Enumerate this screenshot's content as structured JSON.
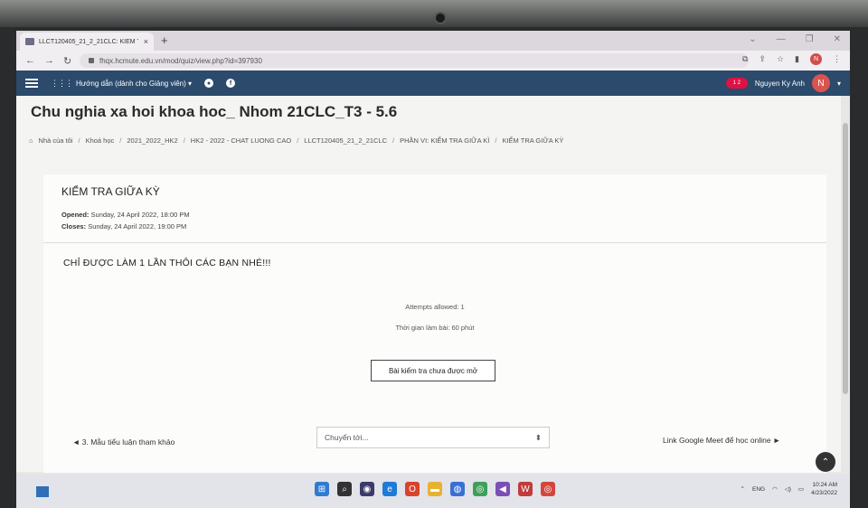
{
  "browser": {
    "tab_title": "LLCT120405_21_2_21CLC: KIỂM T",
    "tab_close": "×",
    "new_tab": "+",
    "url": "fhqx.hcmute.edu.vn/mod/quiz/view.php?id=397930"
  },
  "topnav": {
    "guide_label": "Hướng dẫn (dành cho Giảng viên) ▾",
    "user_name": "Nguyen Ky Anh",
    "user_initial": "N",
    "notification_badge": "1 2"
  },
  "course": {
    "title": "Chu nghia xa hoi khoa hoc_ Nhom 21CLC_T3 - 5.6"
  },
  "breadcrumb": [
    "Nhà của tôi",
    "Khoá học",
    "2021_2022_HK2",
    "HK2 - 2022 - CHAT LUONG CAO",
    "LLCT120405_21_2_21CLC",
    "PHẦN VI: KIỂM TRA GIỮA KÌ",
    "KIỂM TRA GIỮA KỲ"
  ],
  "quiz": {
    "name": "KIỂM TRA GIỮA KỲ",
    "opened_label": "Opened:",
    "opened_value": "Sunday, 24 April 2022, 18:00 PM",
    "closes_label": "Closes:",
    "closes_value": "Sunday, 24 April 2022, 19:00 PM",
    "notice": "CHỈ ĐƯỢC LÀM 1 LẦN THÔI CÁC BẠN NHÉ!!!",
    "attempts": "Attempts allowed: 1",
    "time_limit": "Thời gian làm bài: 60 phút",
    "status_button": "Bài kiểm tra chưa được mở"
  },
  "pager": {
    "prev": "◄ 3. Mẫu tiểu luận tham khảo",
    "jump_placeholder": "Chuyển tới...",
    "next": "Link Google Meet để học online ►"
  },
  "taskbar": {
    "lang": "ENG",
    "time": "10:24 AM",
    "date": "4/23/2022"
  },
  "colors": {
    "nav": "#2b4a6c",
    "avatar": "#d9534f"
  }
}
